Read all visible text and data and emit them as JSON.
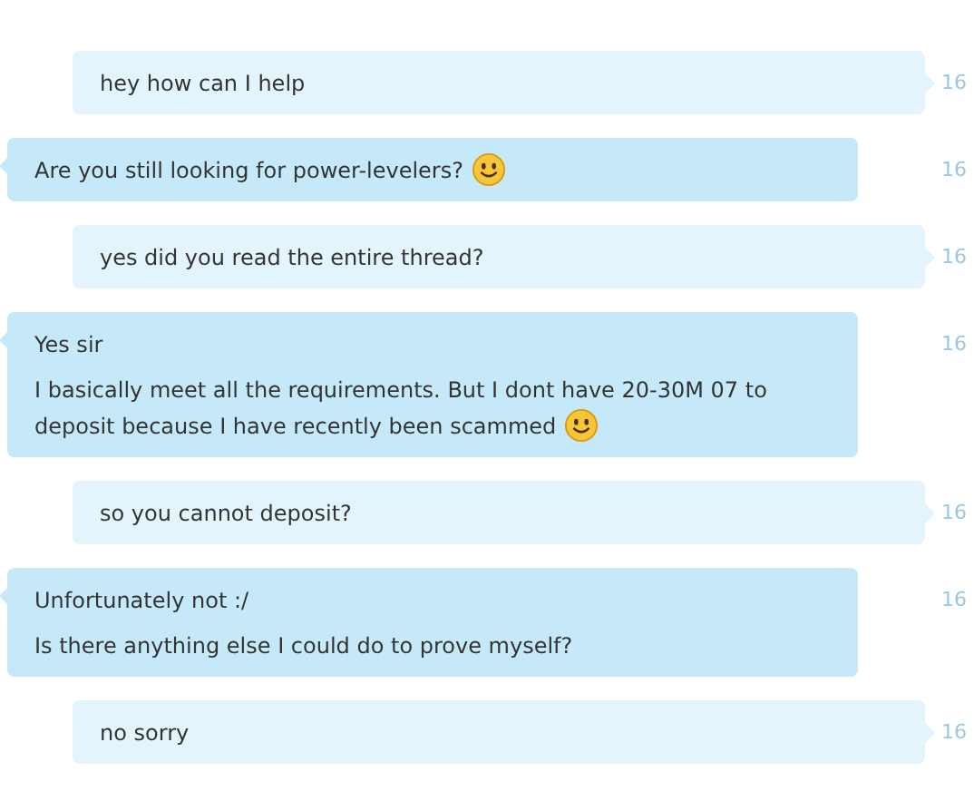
{
  "messages": [
    {
      "kind": "sent",
      "time": "16",
      "lines": [
        {
          "text": "hey how can I help"
        }
      ]
    },
    {
      "kind": "received",
      "time": "16",
      "lines": [
        {
          "text": "Are you still looking for power-levelers?",
          "smiley": true
        }
      ]
    },
    {
      "kind": "sent",
      "time": "16",
      "lines": [
        {
          "text": "yes did you read the entire thread?"
        }
      ]
    },
    {
      "kind": "received",
      "time": "16",
      "lines": [
        {
          "text": "Yes sir"
        },
        {
          "text": "I basically meet all the requirements. But I dont have 20-30M 07 to deposit because I have recently been scammed",
          "smiley": true
        }
      ]
    },
    {
      "kind": "sent",
      "time": "16",
      "lines": [
        {
          "text": "so you cannot deposit?"
        }
      ]
    },
    {
      "kind": "received",
      "time": "16",
      "lines": [
        {
          "text": "Unfortunately not :/"
        },
        {
          "text": "Is there anything else I could do to prove myself?"
        }
      ]
    },
    {
      "kind": "sent",
      "time": "16",
      "lines": [
        {
          "text": "no sorry"
        }
      ]
    }
  ]
}
